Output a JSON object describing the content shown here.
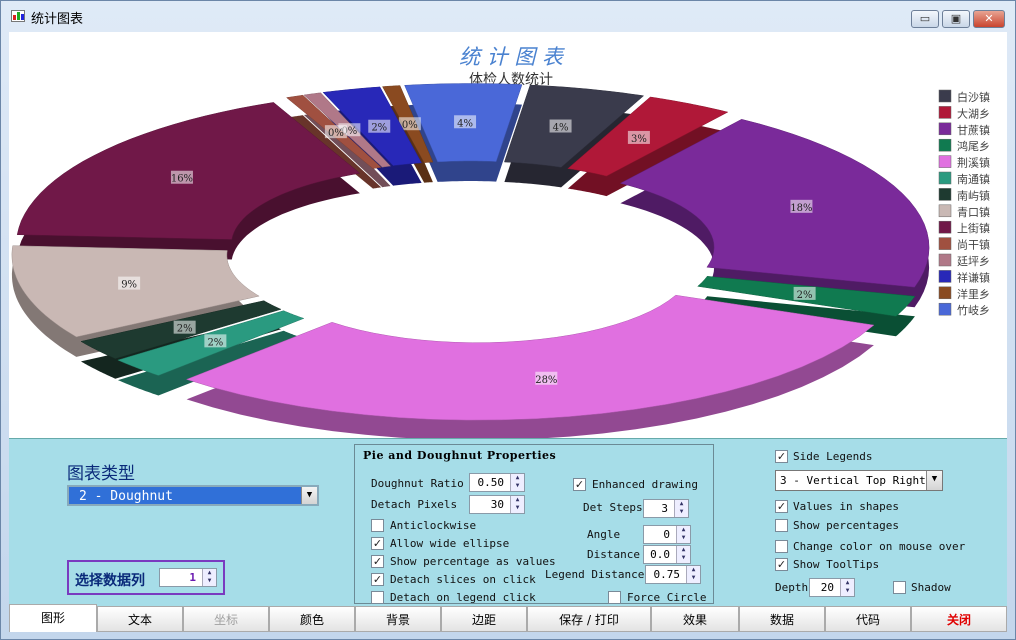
{
  "window": {
    "title": "统计图表",
    "min_label": "▭",
    "max_label": "▣",
    "close_label": "✕"
  },
  "chart_data": {
    "type": "doughnut",
    "title": "统 计 图 表",
    "subtitle": "体检人数统计",
    "legend_position": "top-right",
    "categories": [
      "白沙镇",
      "大湖乡",
      "甘蔗镇",
      "鸿尾乡",
      "荆溪镇",
      "南通镇",
      "南屿镇",
      "青口镇",
      "上街镇",
      "尚干镇",
      "廷坪乡",
      "祥谦镇",
      "洋里乡",
      "竹岐乡"
    ],
    "values": [
      4,
      3,
      18,
      2,
      28,
      2,
      2,
      9,
      16,
      0,
      0,
      2,
      0,
      4
    ],
    "labels": [
      "4%",
      "3%",
      "18%",
      "2%",
      "28%",
      "2%",
      "2%",
      "9%",
      "16%",
      "0%",
      "0%",
      "2%",
      "0%",
      "4%"
    ],
    "extra_labels": [
      "0%",
      "0%"
    ],
    "colors": [
      "#3a3b4c",
      "#b01838",
      "#7a2a9a",
      "#107a50",
      "#e070e0",
      "#2a9a80",
      "#1e3a30",
      "#c9b8b4",
      "#701848",
      "#a05040",
      "#b07888",
      "#2828b8",
      "#8a4a20",
      "#4a68d8"
    ]
  },
  "panel": {
    "chart_type_label": "图表类型",
    "chart_type_value": "2 - Doughnut",
    "series_label": "选择数据列",
    "series_value": "1",
    "group_title": "Pie and Doughnut Properties",
    "doughnut_ratio_label": "Doughnut Ratio",
    "doughnut_ratio_value": "0.50",
    "detach_pixels_label": "Detach Pixels",
    "detach_pixels_value": "30",
    "anticlockwise_label": "Anticlockwise",
    "allow_wide_ellipse_label": "Allow wide ellipse",
    "show_pct_values_label": "Show percentage as values",
    "detach_click_label": "Detach slices on click",
    "detach_legend_label": "Detach on legend click",
    "enhanced_label": "Enhanced drawing",
    "det_steps_label": "Det Steps",
    "det_steps_value": "3",
    "angle_label": "Angle",
    "angle_value": "0",
    "distance_label": "Distance",
    "distance_value": "0.0",
    "legend_distance_label": "Legend Distance",
    "legend_distance_value": "0.75",
    "force_circle_label": "Force Circle",
    "side_legends_label": "Side Legends",
    "legend_pos_value": "3 - Vertical Top Right",
    "values_in_shapes_label": "Values in shapes",
    "show_percentages_label": "Show percentages",
    "change_color_label": "Change color on mouse over",
    "show_tooltips_label": "Show ToolTips",
    "depth_label": "Depth",
    "depth_value": "20",
    "shadow_label": "Shadow",
    "check_mark": "✓"
  },
  "tabs": [
    {
      "label": "图形"
    },
    {
      "label": "文本"
    },
    {
      "label": "坐标"
    },
    {
      "label": "颜色"
    },
    {
      "label": "背景"
    },
    {
      "label": "边距"
    },
    {
      "label": "保存 / 打印"
    },
    {
      "label": "效果"
    },
    {
      "label": "数据"
    },
    {
      "label": "代码"
    },
    {
      "label": "关闭"
    }
  ]
}
